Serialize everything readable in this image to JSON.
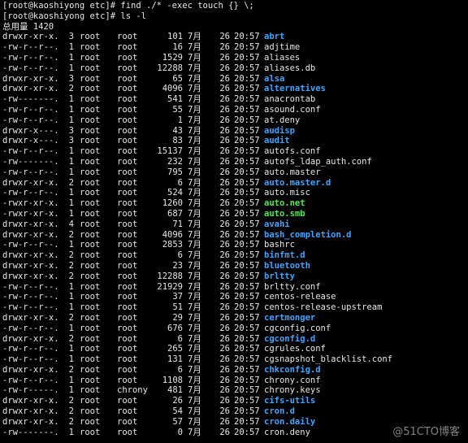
{
  "terminal": {
    "prompt_lines": [
      "[root@kaoshiyong etc]# find ./* -exec touch {} \\;",
      "[root@kaoshiyong etc]# ls -l"
    ],
    "total_line": "总用量 1420",
    "entries": [
      {
        "perm": "drwxr-xr-x.",
        "links": "3",
        "owner": "root",
        "group": "root",
        "size": "101",
        "month": "7月",
        "day": "26",
        "time": "20:57",
        "name": "abrt",
        "type": "dir"
      },
      {
        "perm": "-rw-r--r--.",
        "links": "1",
        "owner": "root",
        "group": "root",
        "size": "16",
        "month": "7月",
        "day": "26",
        "time": "20:57",
        "name": "adjtime",
        "type": "file"
      },
      {
        "perm": "-rw-r--r--.",
        "links": "1",
        "owner": "root",
        "group": "root",
        "size": "1529",
        "month": "7月",
        "day": "26",
        "time": "20:57",
        "name": "aliases",
        "type": "file"
      },
      {
        "perm": "-rw-r--r--.",
        "links": "1",
        "owner": "root",
        "group": "root",
        "size": "12288",
        "month": "7月",
        "day": "26",
        "time": "20:57",
        "name": "aliases.db",
        "type": "file"
      },
      {
        "perm": "drwxr-xr-x.",
        "links": "3",
        "owner": "root",
        "group": "root",
        "size": "65",
        "month": "7月",
        "day": "26",
        "time": "20:57",
        "name": "alsa",
        "type": "dir"
      },
      {
        "perm": "drwxr-xr-x.",
        "links": "2",
        "owner": "root",
        "group": "root",
        "size": "4096",
        "month": "7月",
        "day": "26",
        "time": "20:57",
        "name": "alternatives",
        "type": "dir"
      },
      {
        "perm": "-rw-------.",
        "links": "1",
        "owner": "root",
        "group": "root",
        "size": "541",
        "month": "7月",
        "day": "26",
        "time": "20:57",
        "name": "anacrontab",
        "type": "file"
      },
      {
        "perm": "-rw-r--r--.",
        "links": "1",
        "owner": "root",
        "group": "root",
        "size": "55",
        "month": "7月",
        "day": "26",
        "time": "20:57",
        "name": "asound.conf",
        "type": "file"
      },
      {
        "perm": "-rw-r--r--.",
        "links": "1",
        "owner": "root",
        "group": "root",
        "size": "1",
        "month": "7月",
        "day": "26",
        "time": "20:57",
        "name": "at.deny",
        "type": "file"
      },
      {
        "perm": "drwxr-x---.",
        "links": "3",
        "owner": "root",
        "group": "root",
        "size": "43",
        "month": "7月",
        "day": "26",
        "time": "20:57",
        "name": "audisp",
        "type": "dir"
      },
      {
        "perm": "drwxr-x---.",
        "links": "3",
        "owner": "root",
        "group": "root",
        "size": "83",
        "month": "7月",
        "day": "26",
        "time": "20:57",
        "name": "audit",
        "type": "dir"
      },
      {
        "perm": "-rw-r--r--.",
        "links": "1",
        "owner": "root",
        "group": "root",
        "size": "15137",
        "month": "7月",
        "day": "26",
        "time": "20:57",
        "name": "autofs.conf",
        "type": "file"
      },
      {
        "perm": "-rw-------.",
        "links": "1",
        "owner": "root",
        "group": "root",
        "size": "232",
        "month": "7月",
        "day": "26",
        "time": "20:57",
        "name": "autofs_ldap_auth.conf",
        "type": "file"
      },
      {
        "perm": "-rw-r--r--.",
        "links": "1",
        "owner": "root",
        "group": "root",
        "size": "795",
        "month": "7月",
        "day": "26",
        "time": "20:57",
        "name": "auto.master",
        "type": "file"
      },
      {
        "perm": "drwxr-xr-x.",
        "links": "2",
        "owner": "root",
        "group": "root",
        "size": "6",
        "month": "7月",
        "day": "26",
        "time": "20:57",
        "name": "auto.master.d",
        "type": "dir"
      },
      {
        "perm": "-rw-r--r--.",
        "links": "1",
        "owner": "root",
        "group": "root",
        "size": "524",
        "month": "7月",
        "day": "26",
        "time": "20:57",
        "name": "auto.misc",
        "type": "file"
      },
      {
        "perm": "-rwxr-xr-x.",
        "links": "1",
        "owner": "root",
        "group": "root",
        "size": "1260",
        "month": "7月",
        "day": "26",
        "time": "20:57",
        "name": "auto.net",
        "type": "exec"
      },
      {
        "perm": "-rwxr-xr-x.",
        "links": "1",
        "owner": "root",
        "group": "root",
        "size": "687",
        "month": "7月",
        "day": "26",
        "time": "20:57",
        "name": "auto.smb",
        "type": "exec"
      },
      {
        "perm": "drwxr-xr-x.",
        "links": "4",
        "owner": "root",
        "group": "root",
        "size": "71",
        "month": "7月",
        "day": "26",
        "time": "20:57",
        "name": "avahi",
        "type": "dir"
      },
      {
        "perm": "drwxr-xr-x.",
        "links": "2",
        "owner": "root",
        "group": "root",
        "size": "4096",
        "month": "7月",
        "day": "26",
        "time": "20:57",
        "name": "bash_completion.d",
        "type": "dir"
      },
      {
        "perm": "-rw-r--r--.",
        "links": "1",
        "owner": "root",
        "group": "root",
        "size": "2853",
        "month": "7月",
        "day": "26",
        "time": "20:57",
        "name": "bashrc",
        "type": "file"
      },
      {
        "perm": "drwxr-xr-x.",
        "links": "2",
        "owner": "root",
        "group": "root",
        "size": "6",
        "month": "7月",
        "day": "26",
        "time": "20:57",
        "name": "binfmt.d",
        "type": "dir"
      },
      {
        "perm": "drwxr-xr-x.",
        "links": "2",
        "owner": "root",
        "group": "root",
        "size": "23",
        "month": "7月",
        "day": "26",
        "time": "20:57",
        "name": "bluetooth",
        "type": "dir"
      },
      {
        "perm": "drwxr-xr-x.",
        "links": "2",
        "owner": "root",
        "group": "root",
        "size": "12288",
        "month": "7月",
        "day": "26",
        "time": "20:57",
        "name": "brltty",
        "type": "dir"
      },
      {
        "perm": "-rw-r--r--.",
        "links": "1",
        "owner": "root",
        "group": "root",
        "size": "21929",
        "month": "7月",
        "day": "26",
        "time": "20:57",
        "name": "brltty.conf",
        "type": "file"
      },
      {
        "perm": "-rw-r--r--.",
        "links": "1",
        "owner": "root",
        "group": "root",
        "size": "37",
        "month": "7月",
        "day": "26",
        "time": "20:57",
        "name": "centos-release",
        "type": "file"
      },
      {
        "perm": "-rw-r--r--.",
        "links": "1",
        "owner": "root",
        "group": "root",
        "size": "51",
        "month": "7月",
        "day": "26",
        "time": "20:57",
        "name": "centos-release-upstream",
        "type": "file"
      },
      {
        "perm": "drwxr-xr-x.",
        "links": "2",
        "owner": "root",
        "group": "root",
        "size": "29",
        "month": "7月",
        "day": "26",
        "time": "20:57",
        "name": "certmonger",
        "type": "dir"
      },
      {
        "perm": "-rw-r--r--.",
        "links": "1",
        "owner": "root",
        "group": "root",
        "size": "676",
        "month": "7月",
        "day": "26",
        "time": "20:57",
        "name": "cgconfig.conf",
        "type": "file"
      },
      {
        "perm": "drwxr-xr-x.",
        "links": "2",
        "owner": "root",
        "group": "root",
        "size": "6",
        "month": "7月",
        "day": "26",
        "time": "20:57",
        "name": "cgconfig.d",
        "type": "dir"
      },
      {
        "perm": "-rw-r--r--.",
        "links": "1",
        "owner": "root",
        "group": "root",
        "size": "265",
        "month": "7月",
        "day": "26",
        "time": "20:57",
        "name": "cgrules.conf",
        "type": "file"
      },
      {
        "perm": "-rw-r--r--.",
        "links": "1",
        "owner": "root",
        "group": "root",
        "size": "131",
        "month": "7月",
        "day": "26",
        "time": "20:57",
        "name": "cgsnapshot_blacklist.conf",
        "type": "file"
      },
      {
        "perm": "drwxr-xr-x.",
        "links": "2",
        "owner": "root",
        "group": "root",
        "size": "6",
        "month": "7月",
        "day": "26",
        "time": "20:57",
        "name": "chkconfig.d",
        "type": "dir"
      },
      {
        "perm": "-rw-r--r--.",
        "links": "1",
        "owner": "root",
        "group": "root",
        "size": "1108",
        "month": "7月",
        "day": "26",
        "time": "20:57",
        "name": "chrony.conf",
        "type": "file"
      },
      {
        "perm": "-rw-r-----.",
        "links": "1",
        "owner": "root",
        "group": "chrony",
        "size": "481",
        "month": "7月",
        "day": "26",
        "time": "20:57",
        "name": "chrony.keys",
        "type": "file"
      },
      {
        "perm": "drwxr-xr-x.",
        "links": "2",
        "owner": "root",
        "group": "root",
        "size": "26",
        "month": "7月",
        "day": "26",
        "time": "20:57",
        "name": "cifs-utils",
        "type": "dir"
      },
      {
        "perm": "drwxr-xr-x.",
        "links": "2",
        "owner": "root",
        "group": "root",
        "size": "54",
        "month": "7月",
        "day": "26",
        "time": "20:57",
        "name": "cron.d",
        "type": "dir"
      },
      {
        "perm": "drwxr-xr-x.",
        "links": "2",
        "owner": "root",
        "group": "root",
        "size": "57",
        "month": "7月",
        "day": "26",
        "time": "20:57",
        "name": "cron.daily",
        "type": "dir"
      },
      {
        "perm": "-rw-------.",
        "links": "1",
        "owner": "root",
        "group": "root",
        "size": "0",
        "month": "7月",
        "day": "26",
        "time": "20:57",
        "name": "cron.deny",
        "type": "file"
      }
    ]
  },
  "watermark": "@51CTO博客",
  "colors": {
    "background": "#000000",
    "text": "#e6e6e6",
    "directory": "#3da5ff",
    "executable": "#51e851"
  }
}
